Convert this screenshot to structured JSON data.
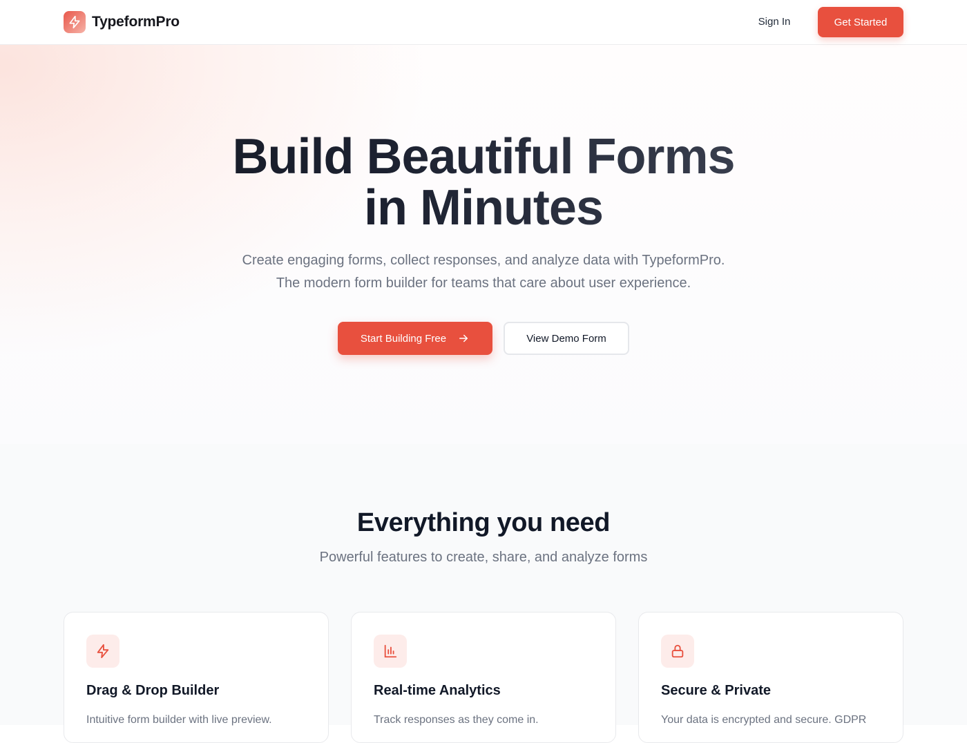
{
  "header": {
    "brand_name": "TypeformPro",
    "sign_in": "Sign In",
    "get_started": "Get Started",
    "logo_icon": "lightning-bolt-icon"
  },
  "hero": {
    "title_line1": "Build Beautiful Forms",
    "title_line2": "in Minutes",
    "subtitle_line1": "Create engaging forms, collect responses, and analyze data with TypeformPro.",
    "subtitle_line2": "The modern form builder for teams that care about user experience.",
    "primary_cta": "Start Building Free",
    "primary_cta_icon": "arrow-right-icon",
    "secondary_cta": "View Demo Form"
  },
  "features": {
    "title": "Everything you need",
    "subtitle": "Powerful features to create, share, and analyze forms",
    "cards": [
      {
        "icon": "lightning-bolt-icon",
        "title": "Drag & Drop Builder",
        "description": "Intuitive form builder with live preview."
      },
      {
        "icon": "bar-chart-icon",
        "title": "Real-time Analytics",
        "description": "Track responses as they come in."
      },
      {
        "icon": "lock-icon",
        "title": "Secure & Private",
        "description": "Your data is encrypted and secure. GDPR"
      }
    ]
  },
  "colors": {
    "accent": "#e8503e",
    "icon_bg": "#fdecea",
    "text_dark": "#111827",
    "text_muted": "#6b7280"
  }
}
